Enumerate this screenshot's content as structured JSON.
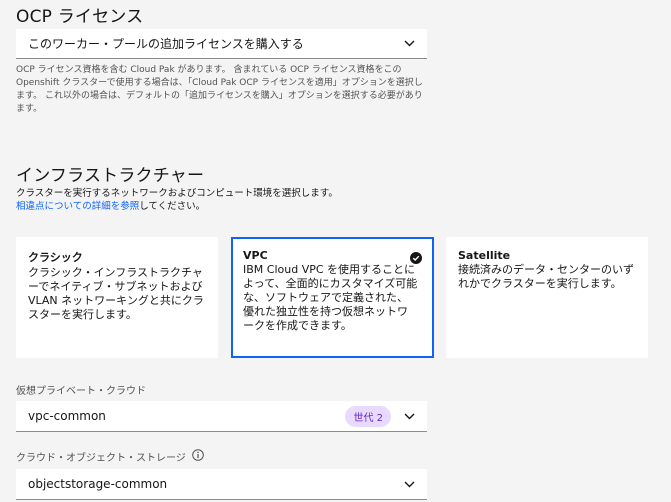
{
  "license": {
    "title": "OCP ライセンス",
    "dropdown_value": "このワーカー・プールの追加ライセンスを購入する",
    "helper": "OCP ライセンス資格を含む Cloud Pak があります。 含まれている OCP ライセンス資格をこの Openshift クラスターで使用する場合は、「Cloud Pak OCP ライセンスを適用」オプションを選択します。 これ以外の場合は、デフォルトの「追加ライセンスを購入」オプションを選択する必要があります。"
  },
  "infra": {
    "title": "インフラストラクチャー",
    "desc_line1": "クラスターを実行するネットワークおよびコンピュート環境を選択します。",
    "desc_link": "相違点についての詳細を参照",
    "desc_suffix": "してください。",
    "tiles": [
      {
        "title": "クラシック",
        "body": "クラシック・インフラストラクチャーでネイティブ・サブネットおよび VLAN ネットワーキングと共にクラスターを実行します。",
        "selected": false
      },
      {
        "title": "VPC",
        "body": "IBM Cloud VPC を使用することによって、全面的にカスタマイズ可能な、ソフトウェアで定義された、優れた独立性を持つ仮想ネットワークを作成できます。",
        "selected": true
      },
      {
        "title": "Satellite",
        "body": "接続済みのデータ・センターのいずれかでクラスターを実行します。",
        "selected": false
      }
    ]
  },
  "vpc": {
    "label": "仮想プライベート・クラウド",
    "value": "vpc-common",
    "tag": "世代 2"
  },
  "cos": {
    "label": "クラウド・オブジェクト・ストレージ",
    "value": "objectstorage-common"
  },
  "colors": {
    "accent": "#0f62fe",
    "tag_bg": "#e8daff",
    "tag_text": "#6929c4",
    "background": "#f4f4f4"
  },
  "icons": {
    "chevron": "chevron-down-icon",
    "selected": "checkmark-filled-icon",
    "info": "information-icon"
  }
}
